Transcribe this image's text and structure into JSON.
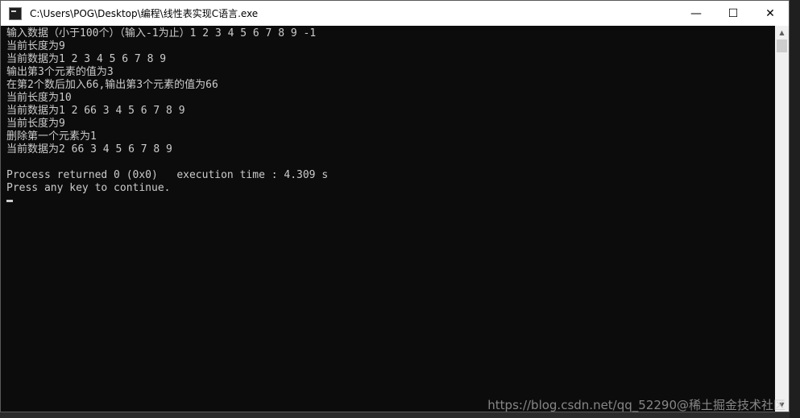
{
  "window": {
    "title": "C:\\Users\\POG\\Desktop\\编程\\线性表实现C语言.exe",
    "minimize_glyph": "—",
    "maximize_glyph": "☐",
    "close_glyph": "✕"
  },
  "console": {
    "lines": [
      "输入数据（小于100个）（输入-1为止）1 2 3 4 5 6 7 8 9 -1",
      "当前长度为9",
      "当前数据为1 2 3 4 5 6 7 8 9",
      "输出第3个元素的值为3",
      "在第2个数后加入66,输出第3个元素的值为66",
      "当前长度为10",
      "当前数据为1 2 66 3 4 5 6 7 8 9",
      "当前长度为9",
      "删除第一个元素为1",
      "当前数据为2 66 3 4 5 6 7 8 9",
      "",
      "Process returned 0 (0x0)   execution time : 4.309 s",
      "Press any key to continue."
    ]
  },
  "scrollbar": {
    "up_glyph": "▲",
    "down_glyph": "▼"
  },
  "watermark": "https://blog.csdn.net/qq_52290@稀土掘金技术社区"
}
